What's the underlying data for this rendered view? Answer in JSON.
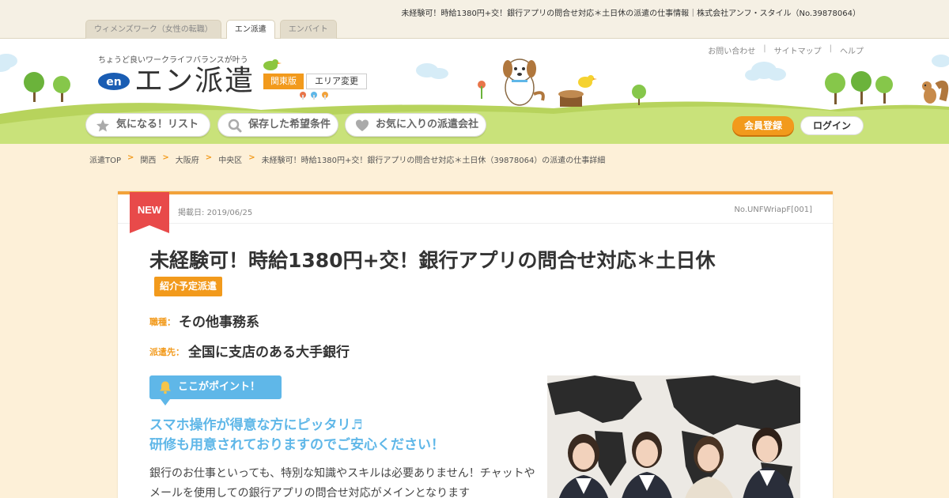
{
  "page_top": {
    "title": "未経験可！時給1380円+交！銀行アプリの問合せ対応＊土日休の派遣の仕事情報｜株式会社アンフ・スタイル（No.39878064）",
    "tabs": [
      {
        "label": "ウィメンズワーク（女性の転職）"
      },
      {
        "label": "エン派遣"
      },
      {
        "label": "エンバイト"
      }
    ]
  },
  "header": {
    "tagline": "ちょうど良いワークライフバランスが叶う",
    "logo_mark": "en",
    "logo_text": "エン派遣",
    "area_label": "関東版",
    "area_change": "エリア変更",
    "util_links": [
      "お問い合わせ",
      "サイトマップ",
      "ヘルプ"
    ],
    "nav": [
      {
        "label": "気になる！リスト",
        "icon": "star-icon"
      },
      {
        "label": "保存した希望条件",
        "icon": "search-icon"
      },
      {
        "label": "お気に入りの派遣会社",
        "icon": "heart-icon"
      }
    ],
    "register_label": "会員登録",
    "login_label": "ログイン"
  },
  "breadcrumb": [
    "派遣TOP",
    "関西",
    "大阪府",
    "中央区",
    "未経験可！時給1380円+交！銀行アプリの問合せ対応＊土日休（39878064）の派遣の仕事詳細"
  ],
  "job": {
    "new_label": "NEW",
    "post_date_label": "掲載日:",
    "post_date": "2019/06/25",
    "job_no": "No.UNFWriapF[001]",
    "title": "未経験可！時給1380円+交！銀行アプリの問合せ対応＊土日休",
    "badge": "紹介予定派遣",
    "job_type_label": "職種：",
    "job_type": "その他事務系",
    "dispatch_label": "派遣先：",
    "dispatch": "全国に支店のある大手銀行",
    "point_label": "ここがポイント！",
    "catch_line1": "スマホ操作が得意な方にピッタリ♬",
    "catch_line2": "研修も用意されておりますのでご安心ください！",
    "body": "銀行のお仕事といっても、特別な知識やスキルは必要ありません！チャットやメールを使用しての銀行アプリの問合せ対応がメインとなります"
  },
  "colors": {
    "accent_orange": "#f29a1c",
    "accent_blue": "#5fb7e8",
    "ribbon_red": "#e84a4a",
    "hill_green": "#c9e27a"
  }
}
